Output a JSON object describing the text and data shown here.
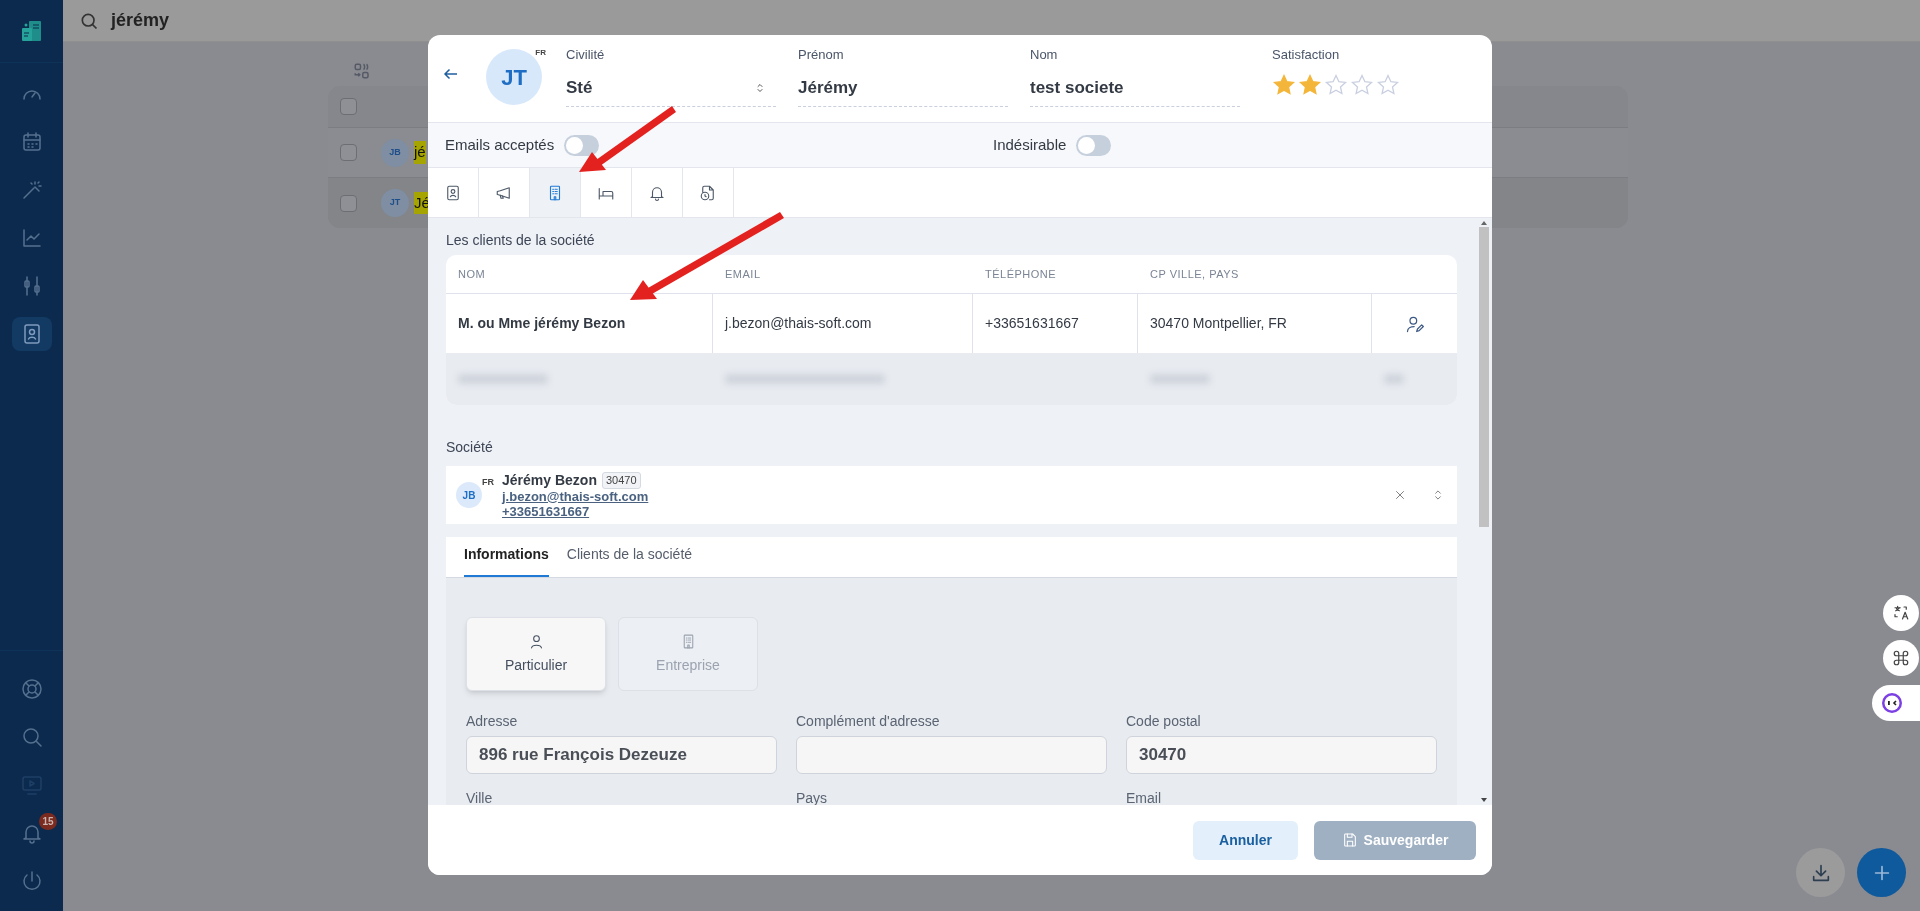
{
  "search": {
    "value": "jérémy"
  },
  "sidebar": {
    "top_items": [
      {
        "kind": "gauge",
        "selected": false
      },
      {
        "kind": "calendar",
        "selected": false
      },
      {
        "kind": "wand",
        "selected": false
      },
      {
        "kind": "chart",
        "selected": false
      },
      {
        "kind": "sliders",
        "selected": false
      },
      {
        "kind": "contacts",
        "selected": true
      }
    ],
    "bottom_items": [
      {
        "kind": "lifebuoy",
        "disabled": false
      },
      {
        "kind": "search",
        "disabled": false
      },
      {
        "kind": "monitor",
        "disabled": true
      },
      {
        "kind": "bell",
        "disabled": false,
        "badge": "15"
      },
      {
        "kind": "power",
        "disabled": false
      }
    ]
  },
  "background_list": {
    "header_checked": false,
    "rows": [
      {
        "initials": "JB",
        "name": "jé",
        "checked": false
      },
      {
        "initials": "JT",
        "name": "Jé",
        "checked": false
      }
    ]
  },
  "modal": {
    "avatar": {
      "initials": "JT",
      "country": "FR"
    },
    "fields": [
      {
        "label": "Civilité",
        "value": "Sté",
        "kind": "select"
      },
      {
        "label": "Prénom",
        "value": "Jérémy",
        "kind": "text"
      },
      {
        "label": "Nom",
        "value": "test societe",
        "kind": "text"
      }
    ],
    "satisfaction": {
      "label": "Satisfaction",
      "stars": 2
    },
    "toggles": [
      {
        "label": "Emails acceptés",
        "on": false
      },
      {
        "label": "Indésirable",
        "on": false
      }
    ],
    "icon_tabs": [
      {
        "kind": "contact",
        "selected": false
      },
      {
        "kind": "megaphone",
        "selected": false
      },
      {
        "kind": "building",
        "selected": true
      },
      {
        "kind": "bed",
        "selected": false
      },
      {
        "kind": "bell",
        "selected": false
      },
      {
        "kind": "file-clock",
        "selected": false
      }
    ],
    "clients": {
      "title": "Les clients de la société",
      "columns": [
        "NOM",
        "EMAIL",
        "TÉLÉPHONE",
        "CP VILLE, PAYS"
      ],
      "rows": [
        {
          "kind": "visible",
          "cells": [
            "M. ou Mme jérémy Bezon",
            "j.bezon@thais-soft.com",
            "+33651631667",
            "30470 Montpellier, FR"
          ]
        },
        {
          "kind": "blurred"
        }
      ]
    },
    "societe": {
      "label": "Société",
      "initials": "JB",
      "country": "FR",
      "name": "Jérémy Bezon",
      "postcode": "30470",
      "email": "j.bezon@thais-soft.com",
      "phone": "+33651631667"
    },
    "info_tabs": [
      {
        "label": "Informations",
        "selected": true
      },
      {
        "label": "Clients de la société",
        "selected": false
      }
    ],
    "type_options": [
      {
        "label": "Particulier",
        "kind": "person",
        "selected": true
      },
      {
        "label": "Entreprise",
        "kind": "building",
        "selected": false
      }
    ],
    "form_fields": [
      {
        "label": "Adresse",
        "value": "896 rue François Dezeuze"
      },
      {
        "label": "Complément d'adresse"
      },
      {
        "label": "Code postal",
        "value": "30470"
      },
      {
        "label": "Ville"
      },
      {
        "label": "Pays"
      },
      {
        "label": "Email"
      }
    ],
    "buttons": [
      {
        "label": "Annuler",
        "kind": "secondary",
        "disabled": false
      },
      {
        "label": "Sauvegarder",
        "kind": "primary",
        "disabled": true
      }
    ]
  },
  "floating": [
    {
      "kind": "translate"
    },
    {
      "kind": "command"
    },
    {
      "kind": "bot"
    }
  ],
  "fabs": [
    {
      "kind": "download"
    },
    {
      "kind": "add"
    }
  ]
}
